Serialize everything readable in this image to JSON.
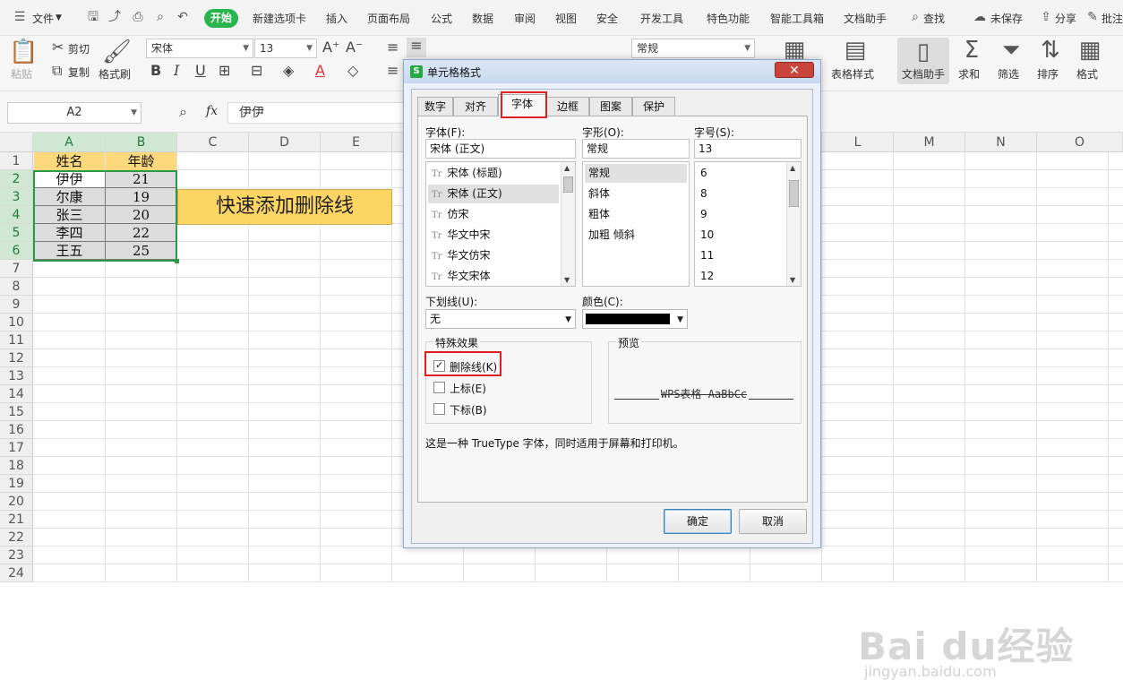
{
  "menubar": {
    "file": "文件",
    "active_tab": "开始",
    "tabs": [
      "新建选项卡",
      "插入",
      "页面布局",
      "公式",
      "数据",
      "审阅",
      "视图",
      "安全",
      "开发工具",
      "特色功能",
      "智能工具箱",
      "文档助手"
    ],
    "search": "查找",
    "unsaved": "未保存",
    "share": "分享",
    "comment": "批注"
  },
  "ribbon": {
    "cut": "剪切",
    "copy": "复制",
    "paste": "粘贴",
    "format_painter": "格式刷",
    "font_name": "宋体",
    "font_size": "13",
    "number_format": "常规",
    "table_style": "表格样式",
    "doc_helper": "文档助手",
    "sum": "求和",
    "filter": "筛选",
    "sort": "排序",
    "format": "格式"
  },
  "formula_bar": {
    "name_box": "A2",
    "fx": "fx",
    "value": "伊伊"
  },
  "sheet": {
    "columns": [
      "A",
      "B",
      "C",
      "D",
      "E",
      "L",
      "M",
      "N",
      "O"
    ],
    "rows": [
      "1",
      "2",
      "3",
      "4",
      "5",
      "6",
      "7",
      "8",
      "9",
      "10",
      "11",
      "12",
      "13",
      "14",
      "15",
      "16",
      "17",
      "18",
      "19",
      "20",
      "21",
      "22",
      "23",
      "24"
    ],
    "header": [
      "姓名",
      "年龄"
    ],
    "data": [
      {
        "name": "伊伊",
        "age": "21"
      },
      {
        "name": "尔康",
        "age": "19"
      },
      {
        "name": "张三",
        "age": "20"
      },
      {
        "name": "李四",
        "age": "22"
      },
      {
        "name": "王五",
        "age": "25"
      }
    ],
    "banner": "快速添加删除线"
  },
  "dialog": {
    "title": "单元格格式",
    "tabs": [
      "数字",
      "对齐",
      "字体",
      "边框",
      "图案",
      "保护"
    ],
    "active_tab": "字体",
    "font_label": "字体(F):",
    "font_value": "宋体 (正文)",
    "fonts": [
      "宋体 (标题)",
      "宋体 (正文)",
      "仿宋",
      "华文中宋",
      "华文仿宋",
      "华文宋体"
    ],
    "style_label": "字形(O):",
    "style_value": "常规",
    "styles": [
      "常规",
      "斜体",
      "粗体",
      "加粗 倾斜"
    ],
    "size_label": "字号(S):",
    "size_value": "13",
    "sizes": [
      "6",
      "8",
      "9",
      "10",
      "11",
      "12"
    ],
    "underline_label": "下划线(U):",
    "underline_value": "无",
    "color_label": "颜色(C):",
    "color_value": "#000000",
    "effects_title": "特殊效果",
    "strikethrough": "删除线(K)",
    "superscript": "上标(E)",
    "subscript": "下标(B)",
    "preview_title": "预览",
    "preview_text": "WPS表格  AaBbCc",
    "info": "这是一种 TrueType 字体，同时适用于屏幕和打印机。",
    "ok": "确定",
    "cancel": "取消"
  },
  "watermark": {
    "logo": "Bai du经验",
    "url": "jingyan.baidu.com"
  }
}
